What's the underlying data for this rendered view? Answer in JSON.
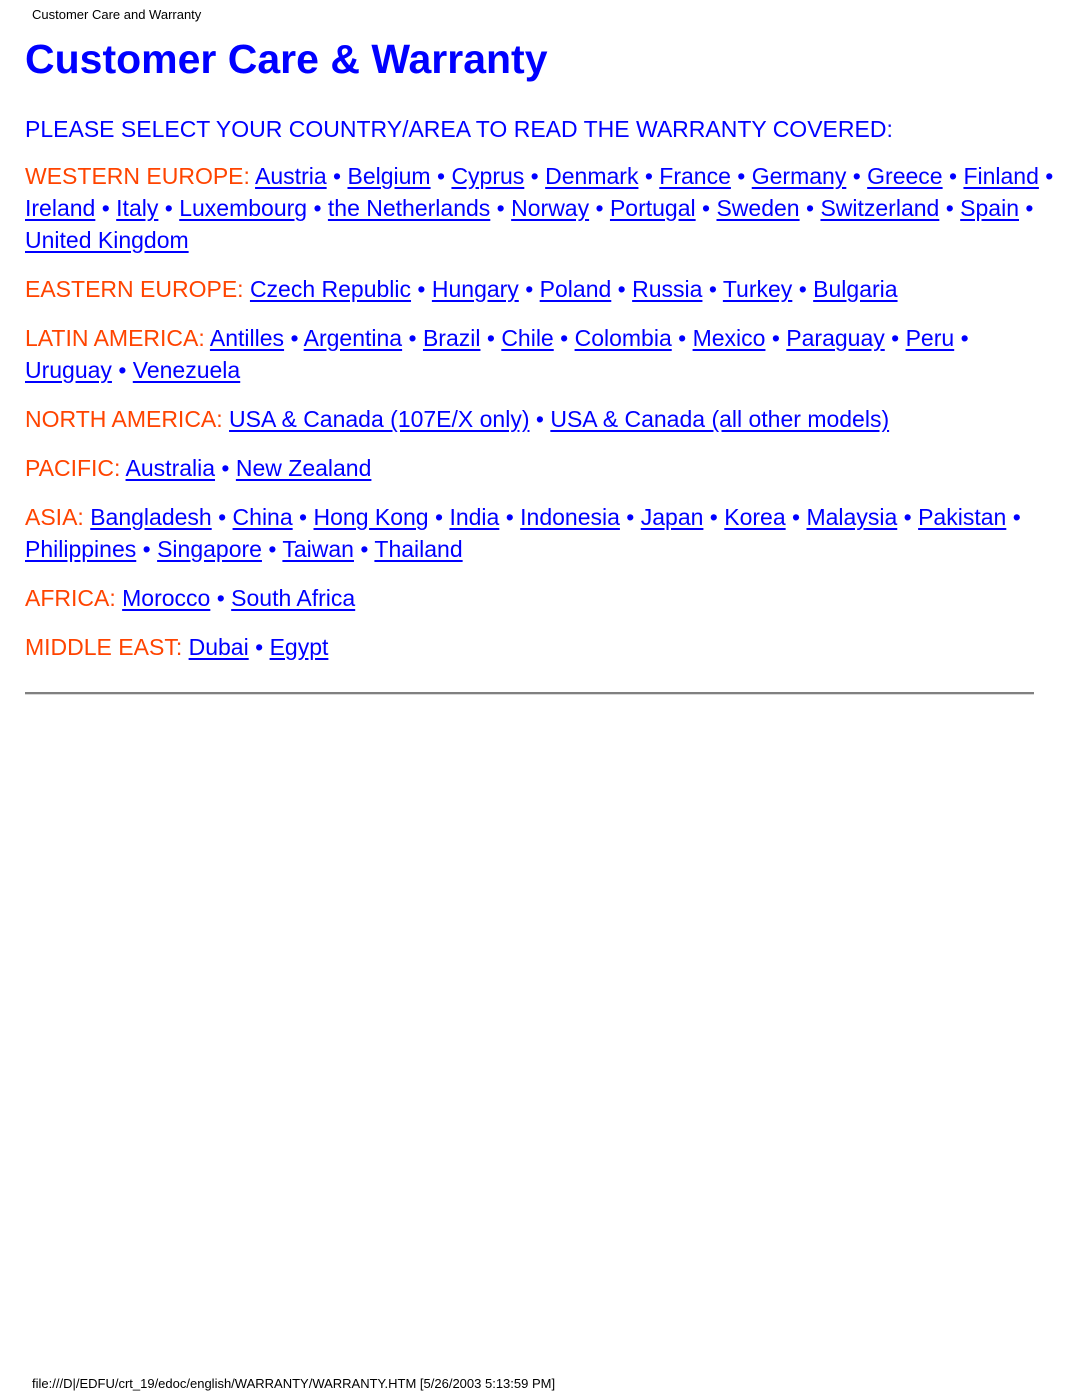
{
  "print_header": "Customer Care and Warranty",
  "title": "Customer Care & Warranty",
  "instruction": "PLEASE SELECT YOUR COUNTRY/AREA TO READ THE WARRANTY COVERED:",
  "separator": "•",
  "colors": {
    "link": "#0000ff",
    "region_label": "#ff4400"
  },
  "regions": [
    {
      "label": "WESTERN EUROPE:",
      "links": [
        "Austria",
        "Belgium",
        "Cyprus",
        "Denmark",
        "France",
        "Germany",
        "Greece",
        "Finland",
        "Ireland",
        "Italy",
        "Luxembourg",
        "the Netherlands",
        "Norway",
        "Portugal",
        "Sweden",
        "Switzerland",
        "Spain",
        "United Kingdom"
      ]
    },
    {
      "label": "EASTERN EUROPE:",
      "links": [
        "Czech Republic",
        "Hungary",
        "Poland",
        "Russia",
        "Turkey",
        "Bulgaria"
      ]
    },
    {
      "label": "LATIN AMERICA:",
      "links": [
        "Antilles",
        "Argentina",
        "Brazil",
        "Chile",
        "Colombia",
        "Mexico",
        "Paraguay",
        "Peru",
        "Uruguay",
        "Venezuela"
      ]
    },
    {
      "label": "NORTH AMERICA:",
      "links": [
        "USA & Canada (107E/X only)",
        "USA & Canada (all other models)"
      ]
    },
    {
      "label": "PACIFIC:",
      "links": [
        "Australia",
        "New Zealand"
      ]
    },
    {
      "label": "ASIA:",
      "links": [
        "Bangladesh",
        "China",
        "Hong Kong",
        "India",
        "Indonesia",
        "Japan",
        "Korea",
        "Malaysia",
        "Pakistan",
        "Philippines",
        "Singapore",
        "Taiwan",
        "Thailand"
      ]
    },
    {
      "label": "AFRICA:",
      "links": [
        "Morocco",
        "South Africa"
      ]
    },
    {
      "label": "MIDDLE EAST:",
      "links": [
        "Dubai",
        "Egypt"
      ]
    }
  ],
  "print_footer": "file:///D|/EDFU/crt_19/edoc/english/WARRANTY/WARRANTY.HTM [5/26/2003 5:13:59 PM]"
}
